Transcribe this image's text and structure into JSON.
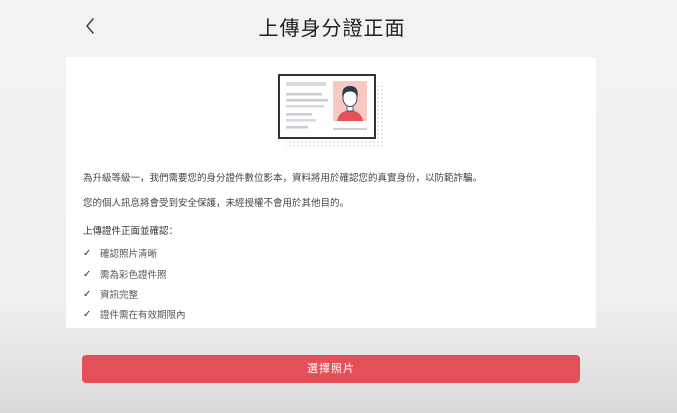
{
  "header": {
    "title": "上傳身分證正面",
    "back_icon": "chevron-left-icon"
  },
  "card": {
    "illustration_icon": "id-card-icon",
    "paragraphs": [
      "為升級等級一，我們需要您的身分證件數位影本，資料將用於確認您的真實身份，以防範詐騙。",
      "您的個人訊息將會受到安全保護，未經授權不會用於其他目的。"
    ],
    "section_title": "上傳證件正面並確認：",
    "check_mark": "✓",
    "checklist": [
      "確認照片清晰",
      "需為彩色證件照",
      "資訊完整",
      "證件需在有效期限內"
    ]
  },
  "footer": {
    "select_photo_label": "選擇照片"
  },
  "colors": {
    "accent": "#e4505a",
    "avatar_bg": "#f7c9c2",
    "avatar_shirt": "#e4505a",
    "avatar_hair": "#2f3b4a"
  }
}
